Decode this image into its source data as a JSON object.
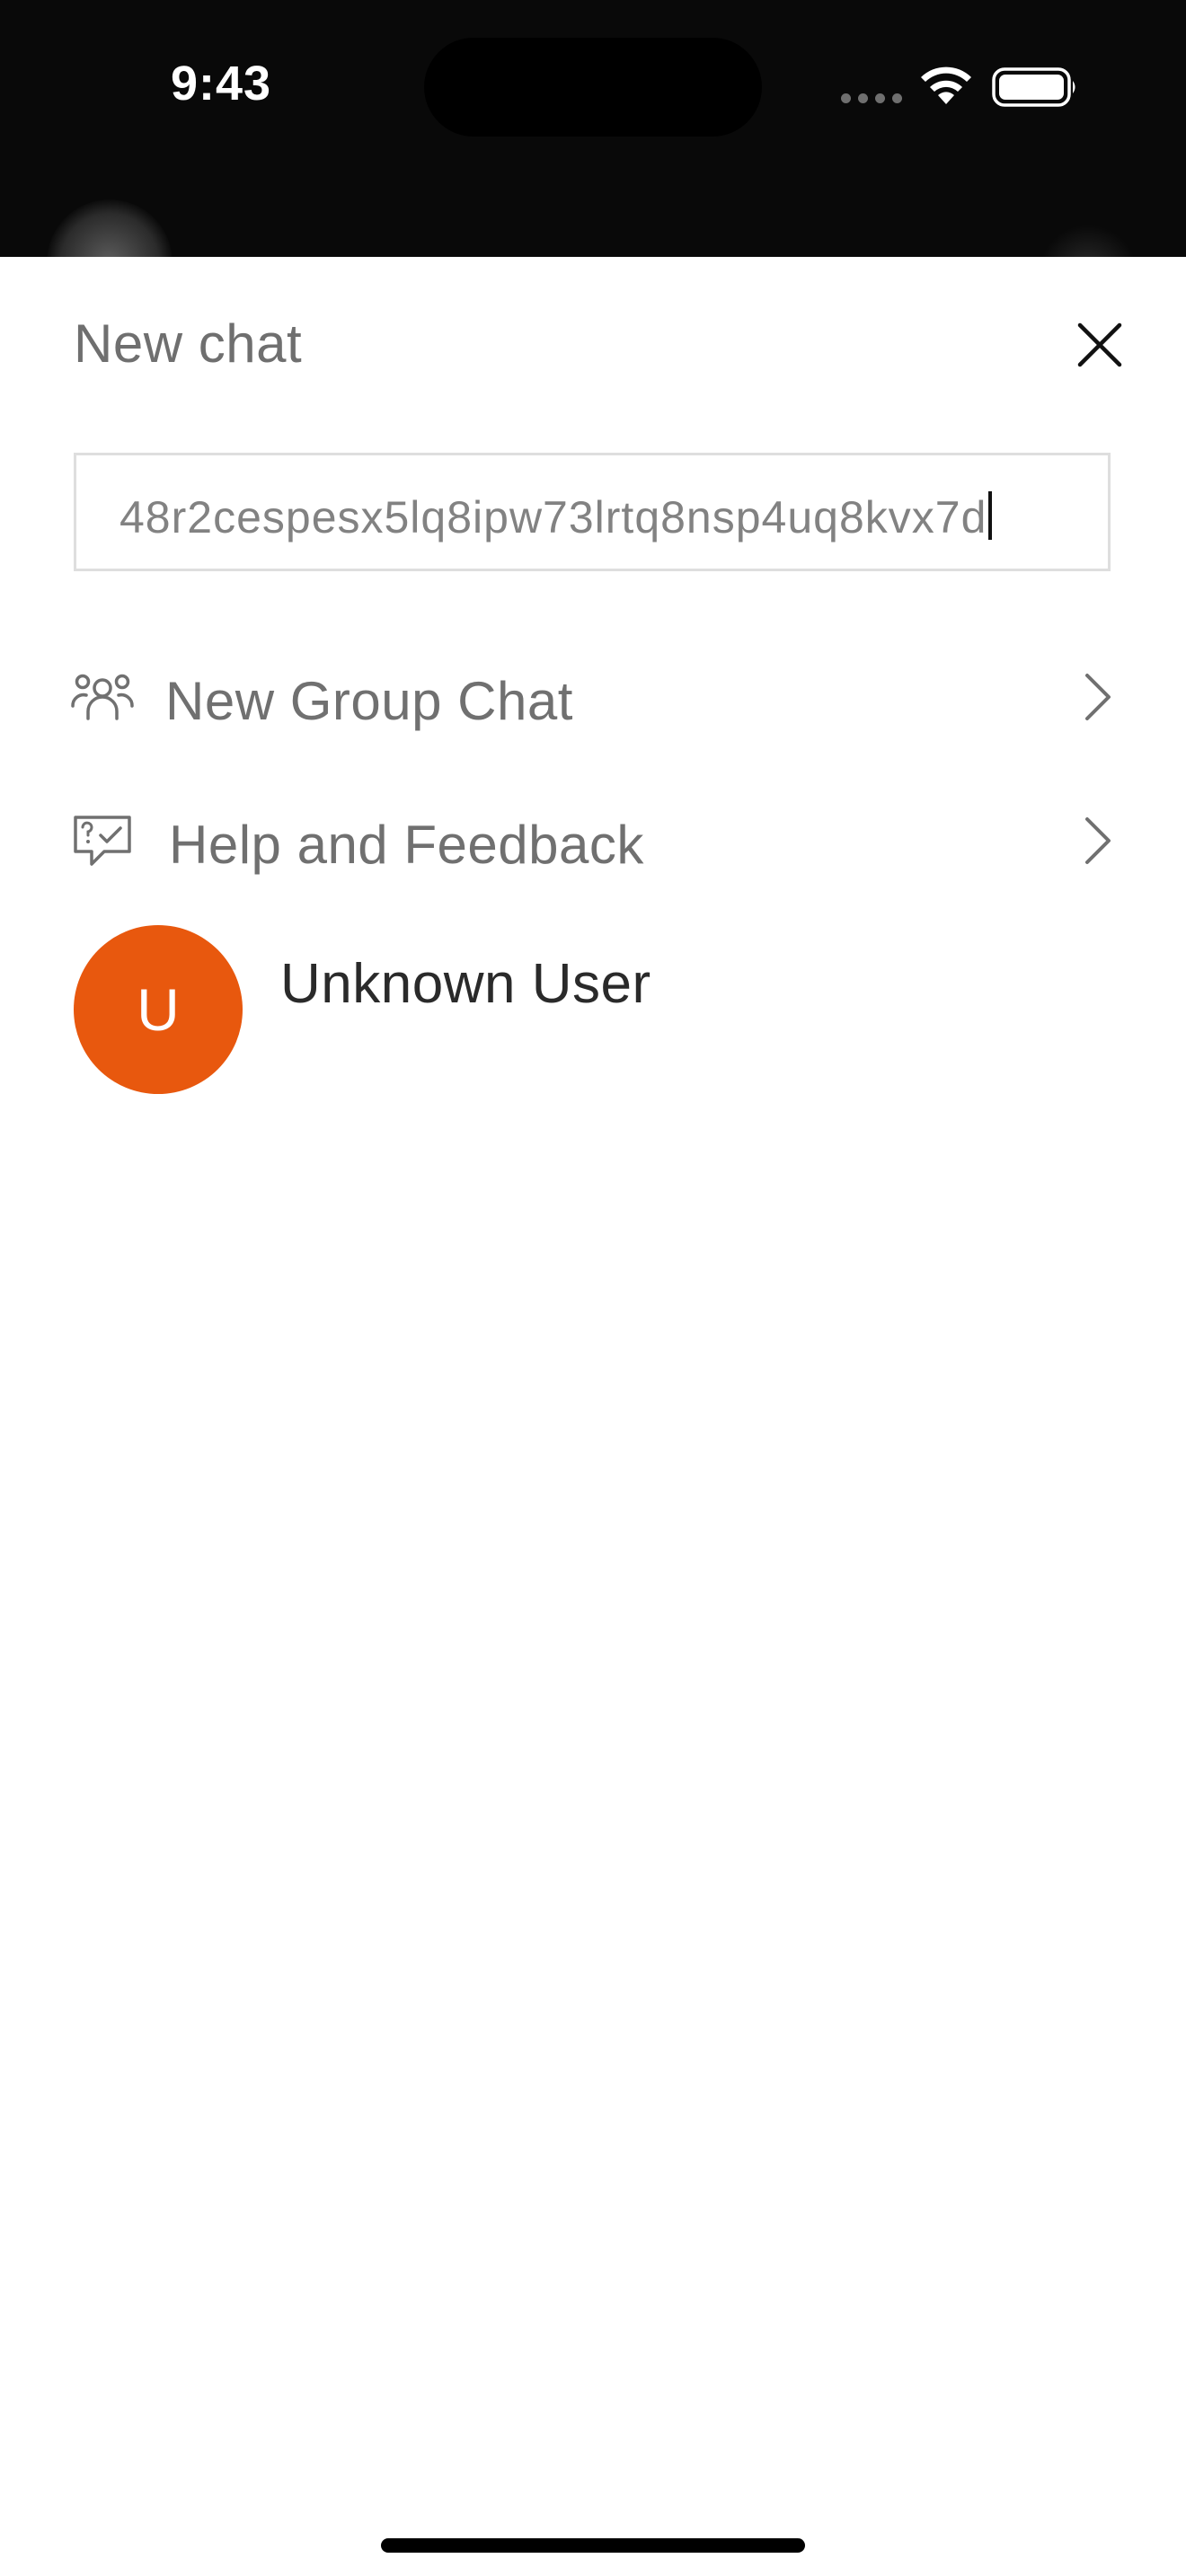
{
  "status_bar": {
    "time": "9:43",
    "wifi_icon": "wifi-icon",
    "battery_icon": "battery-icon"
  },
  "sheet": {
    "title": "New chat",
    "close_icon": "close-icon"
  },
  "search": {
    "value": "48r2cespesx5lq8ipw73lrtq8nsp4uq8kvx7d"
  },
  "menu": {
    "items": [
      {
        "label": "New Group Chat",
        "icon": "group-users-icon"
      },
      {
        "label": "Help and Feedback",
        "icon": "feedback-chat-icon"
      }
    ]
  },
  "results": {
    "users": [
      {
        "initial": "U",
        "name": "Unknown User"
      }
    ]
  },
  "colors": {
    "avatar": "#e8580e",
    "text_muted": "#707070",
    "status_bar_bg": "#090909"
  }
}
